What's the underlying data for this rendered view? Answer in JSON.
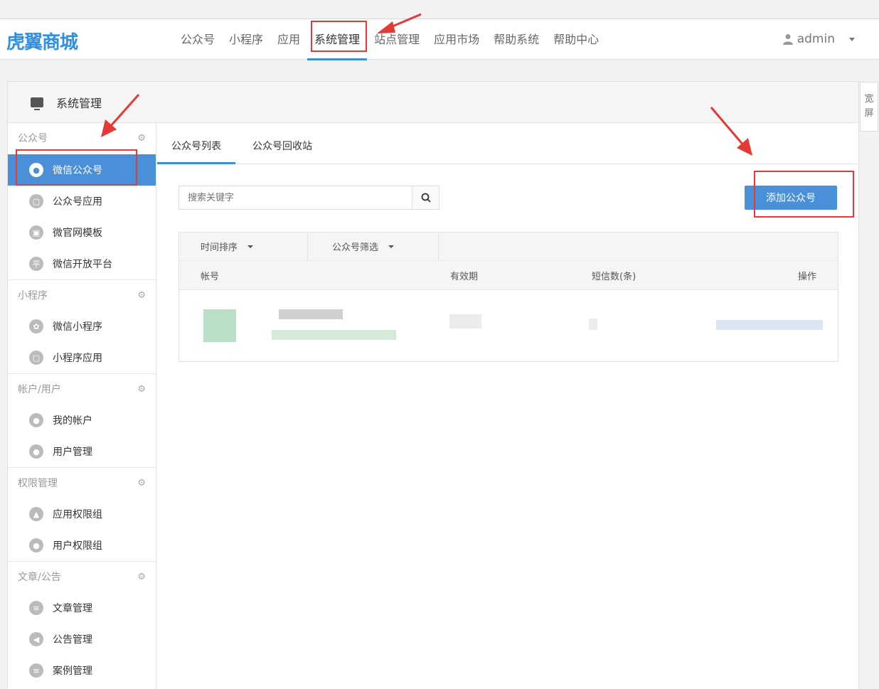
{
  "header": {
    "logo": "虎翼商城",
    "nav": [
      "公众号",
      "小程序",
      "应用",
      "系统管理",
      "站点管理",
      "应用市场",
      "帮助系统",
      "帮助中心"
    ],
    "active_nav": "系统管理",
    "user": "admin"
  },
  "panel": {
    "title": "系统管理",
    "wide_screen": [
      "宽",
      "屏"
    ]
  },
  "sidebar": {
    "sections": [
      {
        "title": "公众号",
        "items": [
          "微信公众号",
          "公众号应用",
          "微官网模板",
          "微信开放平台"
        ]
      },
      {
        "title": "小程序",
        "items": [
          "微信小程序",
          "小程序应用"
        ]
      },
      {
        "title": "帐户/用户",
        "items": [
          "我的帐户",
          "用户管理"
        ]
      },
      {
        "title": "权限管理",
        "items": [
          "应用权限组",
          "用户权限组"
        ]
      },
      {
        "title": "文章/公告",
        "items": [
          "文章管理",
          "公告管理",
          "案例管理"
        ]
      }
    ],
    "active_item": "微信公众号"
  },
  "content": {
    "tabs": [
      "公众号列表",
      "公众号回收站"
    ],
    "search_placeholder": "搜索关键字",
    "add_button": "添加公众号",
    "filters": [
      "时间排序",
      "公众号筛选"
    ],
    "columns": [
      "帐号",
      "有效期",
      "短信数(条)",
      "操作"
    ]
  },
  "colors": {
    "accent": "#4a90d9",
    "annotation": "#e53935"
  }
}
